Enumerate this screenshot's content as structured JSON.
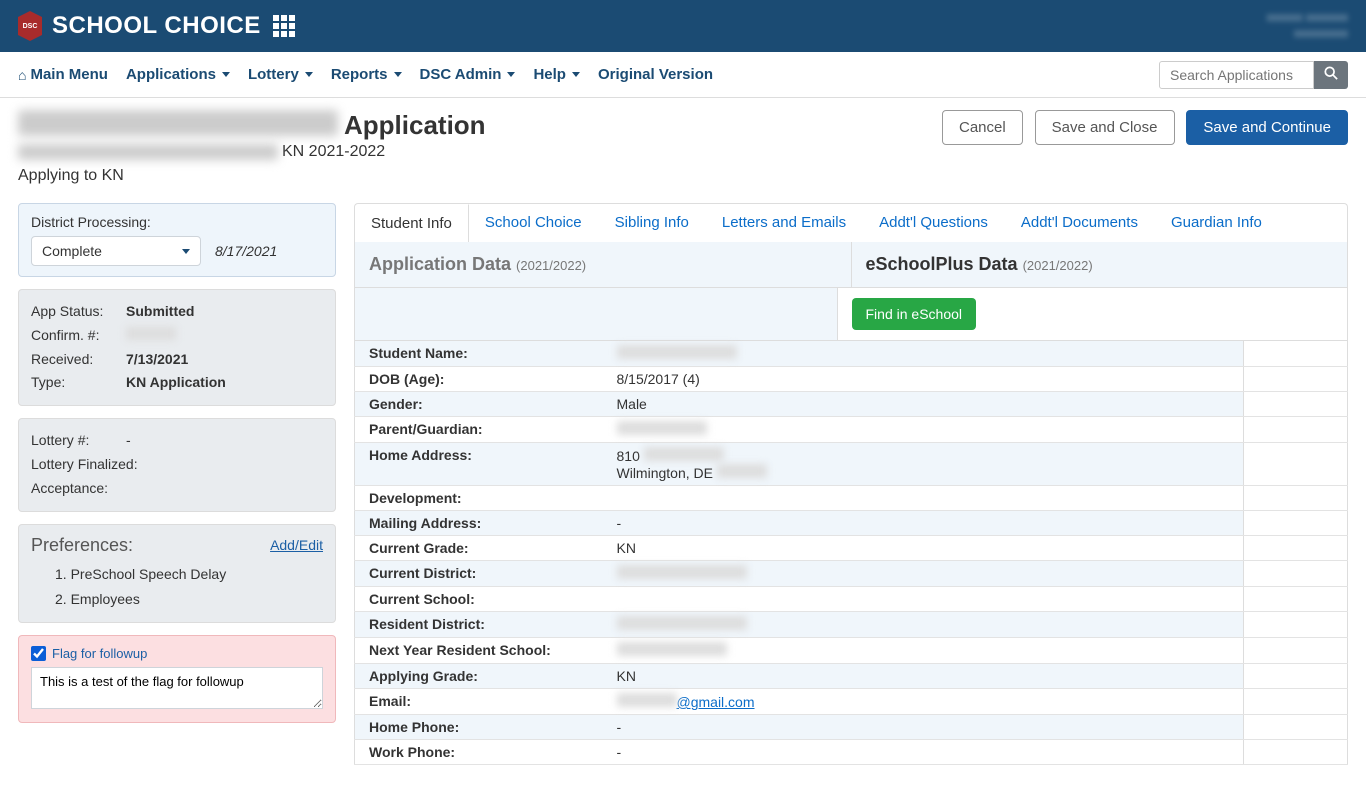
{
  "brand": "SCHOOL CHOICE",
  "nav": {
    "main_menu": "Main Menu",
    "applications": "Applications",
    "lottery": "Lottery",
    "reports": "Reports",
    "dsc_admin": "DSC Admin",
    "help": "Help",
    "original": "Original Version",
    "search_placeholder": "Search Applications"
  },
  "header": {
    "title_suffix": "Application",
    "year": "KN 2021-2022",
    "applying": "Applying to KN",
    "cancel": "Cancel",
    "save_close": "Save and Close",
    "save_continue": "Save and Continue"
  },
  "sidebar": {
    "dp_label": "District Processing:",
    "dp_value": "Complete",
    "dp_date": "8/17/2021",
    "app_status_k": "App Status:",
    "app_status_v": "Submitted",
    "confirm_k": "Confirm. #:",
    "received_k": "Received:",
    "received_v": "7/13/2021",
    "type_k": "Type:",
    "type_v": "KN Application",
    "lottery_num_k": "Lottery #:",
    "lottery_num_v": "-",
    "lottery_fin_k": "Lottery Finalized:",
    "acceptance_k": "Acceptance:",
    "pref_title": "Preferences:",
    "pref_edit": "Add/Edit",
    "pref1": "1. PreSchool Speech Delay",
    "pref2": "2. Employees",
    "flag_label": "Flag for followup",
    "flag_text": "This is a test of the flag for followup"
  },
  "tabs": {
    "student": "Student Info",
    "choice": "School Choice",
    "sibling": "Sibling Info",
    "letters": "Letters and Emails",
    "questions": "Addt'l Questions",
    "docs": "Addt'l Documents",
    "guardian": "Guardian Info"
  },
  "data": {
    "app_title": "Application Data",
    "esc_title": "eSchoolPlus Data",
    "year": "(2021/2022)",
    "find_btn": "Find in eSchool",
    "rows": {
      "name_k": "Student Name:",
      "dob_k": "DOB (Age):",
      "dob_v": "8/15/2017  (4)",
      "gender_k": "Gender:",
      "gender_v": "Male",
      "parent_k": "Parent/Guardian:",
      "addr_k": "Home Address:",
      "addr_v1": "810",
      "addr_v2": "Wilmington, DE",
      "dev_k": "Development:",
      "mail_k": "Mailing Address:",
      "mail_v": "-",
      "curr_grade_k": "Current Grade:",
      "curr_grade_v": "KN",
      "curr_dist_k": "Current District:",
      "curr_school_k": "Current School:",
      "res_dist_k": "Resident District:",
      "next_school_k": "Next Year Resident School:",
      "apply_grade_k": "Applying Grade:",
      "apply_grade_v": "KN",
      "email_k": "Email:",
      "email_v": "@gmail.com",
      "home_phone_k": "Home Phone:",
      "home_phone_v": "-",
      "work_phone_k": "Work Phone:",
      "work_phone_v": "-"
    }
  }
}
